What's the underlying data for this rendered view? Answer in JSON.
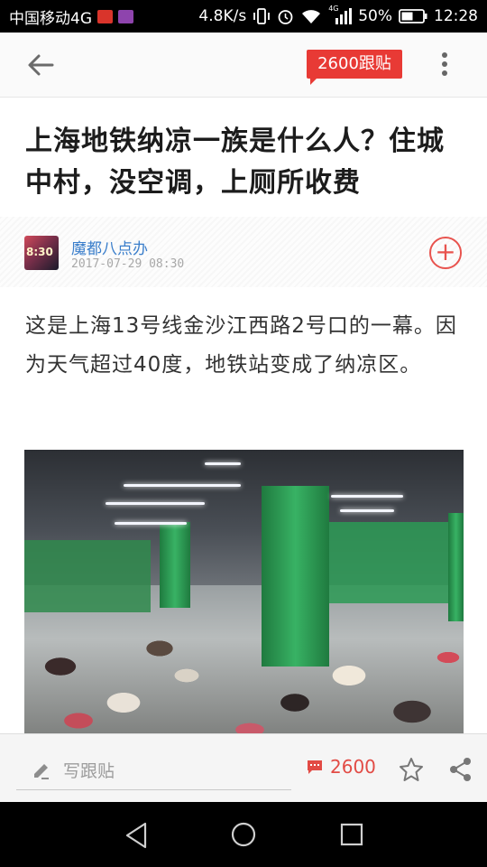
{
  "status_bar": {
    "carrier": "中国移动4G",
    "speed": "4.8K/s",
    "network": "4G",
    "battery": "50%",
    "time": "12:28"
  },
  "app_bar": {
    "follow_count_label": "2600跟贴"
  },
  "article": {
    "title": "上海地铁纳凉一族是什么人？住城中村，没空调，上厕所收费",
    "author": "魔都八点办",
    "date": "2017-07-29 08:30",
    "body": "这是上海13号线金沙江西路2号口的一幕。因为天气超过40度，地铁站变成了纳凉区。",
    "follow_button": "+"
  },
  "action_bar": {
    "comment_placeholder": "写跟贴",
    "comment_count": "2600"
  },
  "colors": {
    "accent": "#e83a35",
    "author_link": "#3a7ecb"
  },
  "icons": [
    "back-arrow-icon",
    "more-vert-icon",
    "plus-icon",
    "pencil-icon",
    "comment-icon",
    "star-icon",
    "share-icon",
    "nav-back-icon",
    "nav-home-icon",
    "nav-recent-icon"
  ]
}
